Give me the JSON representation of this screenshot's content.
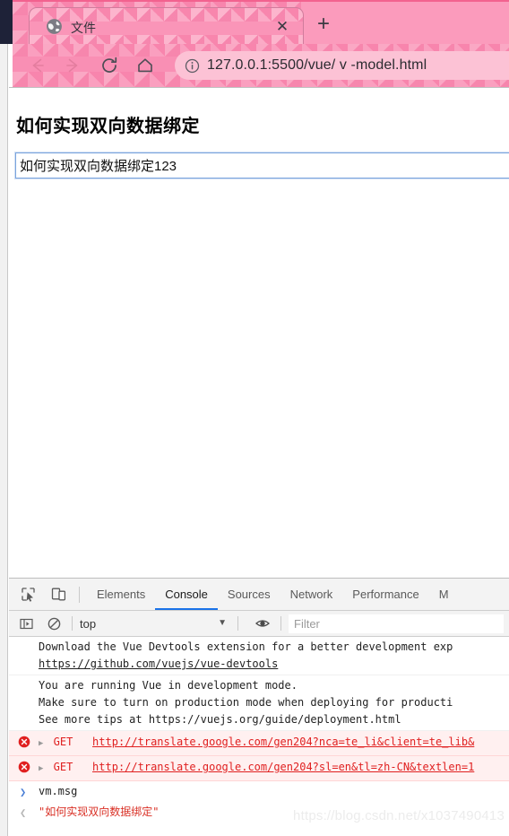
{
  "browser": {
    "tab": {
      "title": "文件",
      "favicon_icon": "globe-icon",
      "close_icon": "close-icon"
    },
    "new_tab_label": "+",
    "nav": {
      "back_icon": "arrow-left-icon",
      "forward_icon": "arrow-right-icon",
      "reload_icon": "reload-icon",
      "home_icon": "home-icon"
    },
    "omnibox": {
      "info_icon": "info-circle-icon",
      "url": "127.0.0.1:5500/vue/ v -model.html"
    },
    "theme": {
      "chrome_pink": "#f98fb4",
      "tab_pink": "#fa95b8",
      "omnibox_pink": "#fcc2d5",
      "top_line": "#f2628f",
      "os_dark": "#1e2238"
    }
  },
  "page": {
    "heading": "如何实现双向数据绑定",
    "input_value": "如何实现双向数据绑定123",
    "input_placeholder": ""
  },
  "devtools": {
    "inspect_icon": "inspect-cursor-icon",
    "device_icon": "device-toolbar-icon",
    "tabs": [
      {
        "label": "Elements",
        "active": false
      },
      {
        "label": "Console",
        "active": true
      },
      {
        "label": "Sources",
        "active": false
      },
      {
        "label": "Network",
        "active": false
      },
      {
        "label": "Performance",
        "active": false
      },
      {
        "label": "M",
        "active": false
      }
    ],
    "active_tab": "Console",
    "filterbar": {
      "sidebar_icon": "console-sidebar-icon",
      "clear_icon": "clear-console-icon",
      "context": "top",
      "caret_icon": "chevron-down-icon",
      "eye_icon": "eye-icon",
      "filter_placeholder": "Filter"
    },
    "console": {
      "messages": [
        {
          "type": "log",
          "lines": [
            "Download the Vue Devtools extension for a better development exp",
            "https://github.com/vuejs/vue-devtools"
          ],
          "link_line": 1
        },
        {
          "type": "log",
          "lines": [
            "You are running Vue in development mode.",
            "Make sure to turn on production mode when deploying for producti",
            "See more tips at https://vuejs.org/guide/deployment.html"
          ],
          "link_line": -1
        },
        {
          "type": "error",
          "icon": "error-circle-icon",
          "expand_icon": "expand-triangle-icon",
          "method": "GET",
          "url": "http://translate.google.com/gen204?nca=te_li&client=te_lib&"
        },
        {
          "type": "error",
          "icon": "error-circle-icon",
          "expand_icon": "expand-triangle-icon",
          "method": "GET",
          "url": "http://translate.google.com/gen204?sl=en&tl=zh-CN&textlen=1"
        }
      ],
      "input_prompt_icon": "chevron-right-icon",
      "input_expression": "vm.msg",
      "output_prompt_icon": "chevron-left-icon",
      "output_value": "\"如何实现双向数据绑定\"",
      "error_color": "#e02020",
      "output_color": "#d93025"
    }
  },
  "watermark": "https://blog.csdn.net/x1037490413"
}
